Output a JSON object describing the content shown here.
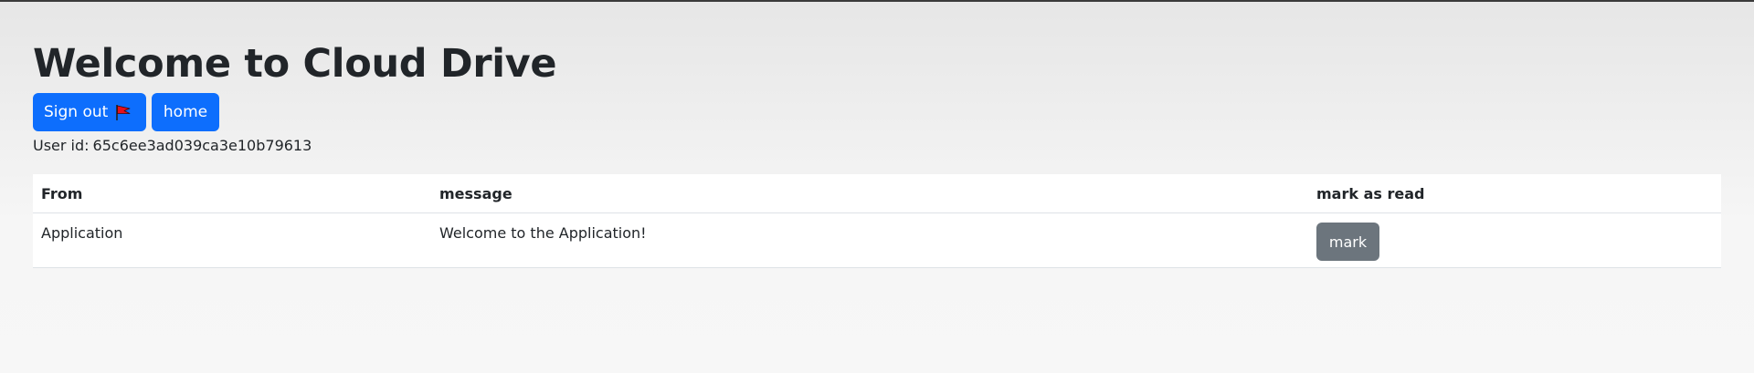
{
  "page": {
    "title": "Welcome to Cloud Drive"
  },
  "actions": {
    "signout_label": "Sign out",
    "signout_icon": "flag-icon",
    "home_label": "home",
    "button_color": "#0d6efd"
  },
  "user": {
    "id_label": "User id:",
    "id_value": "65c6ee3ad039ca3e10b79613"
  },
  "messages_table": {
    "headers": [
      "From",
      "message",
      "mark as read"
    ],
    "rows": [
      {
        "from": "Application",
        "message": "Welcome to the Application!",
        "action_label": "mark"
      }
    ],
    "action_button_color": "#6c757d"
  }
}
